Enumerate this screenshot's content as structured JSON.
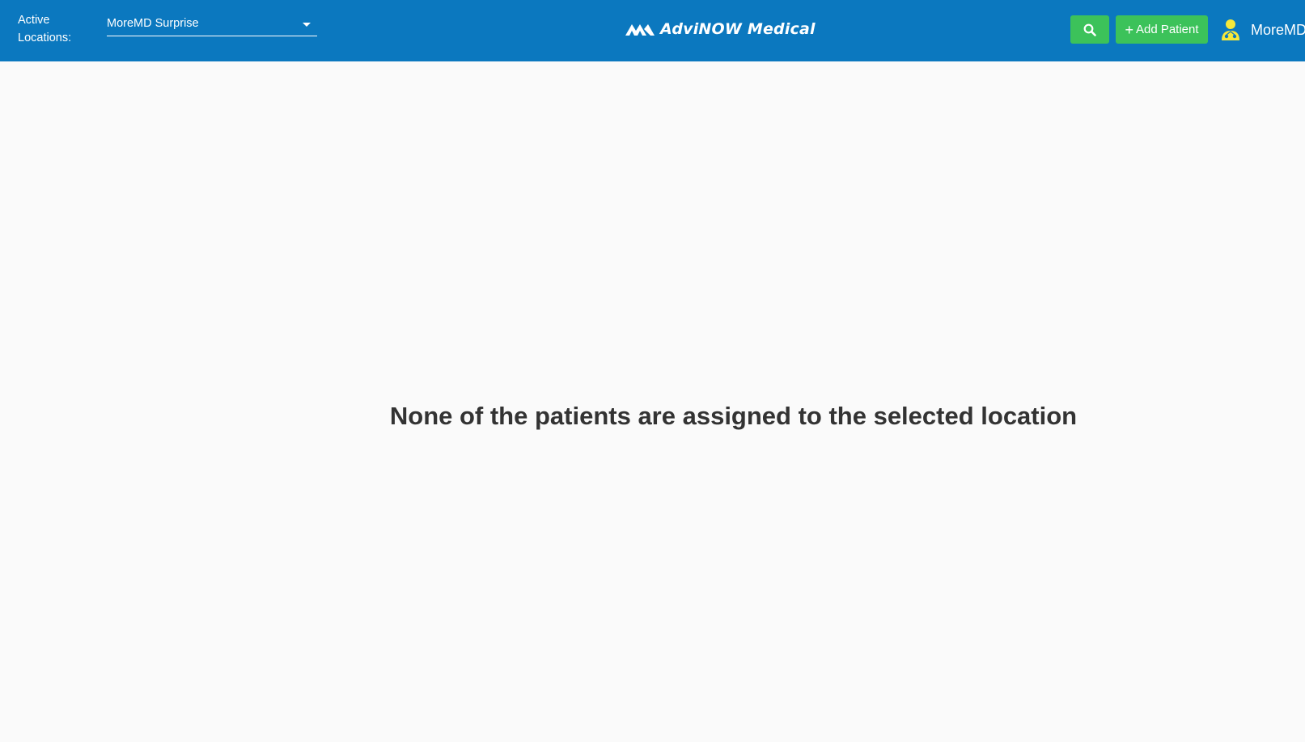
{
  "header": {
    "active_locations_label": "Active Locations:",
    "location_select": {
      "value": "MoreMD Surprise"
    },
    "logo_text": "AdviNOW Medical",
    "search_button_icon": "search-icon",
    "add_patient_label": "Add Patient",
    "user_name": "MoreMD",
    "user_icon": "doctor-icon"
  },
  "main": {
    "empty_message": "None of the patients are assigned to the selected location"
  },
  "colors": {
    "header_bg": "#0b78bf",
    "button_green": "#3cc25a",
    "user_icon": "#f5e83a",
    "background": "#fafafa",
    "text_dark": "#333333"
  }
}
